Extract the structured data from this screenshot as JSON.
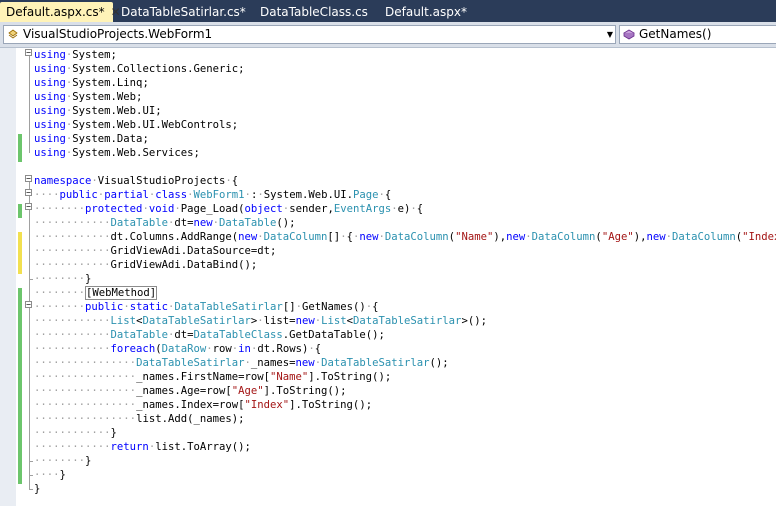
{
  "tabs": [
    {
      "label": "Default.aspx.cs*",
      "active": true
    },
    {
      "label": "DataTableSatirlar.cs*",
      "active": false
    },
    {
      "label": "DataTableClass.cs",
      "active": false
    },
    {
      "label": "Default.aspx*",
      "active": false
    }
  ],
  "navbar": {
    "class_combo": "VisualStudioProjects.WebForm1",
    "member_combo": "GetNames()"
  },
  "colors": {
    "keyword": "#0000ff",
    "type": "#2b91af",
    "string": "#a31515",
    "whitespace": "#a0a0a0",
    "change_saved": "#6cc56c",
    "change_unsaved": "#f2e050"
  },
  "code_lines": [
    [
      [
        "kw",
        "using"
      ],
      [
        "ws",
        "·"
      ],
      [
        "n",
        "System;"
      ]
    ],
    [
      [
        "kw",
        "using"
      ],
      [
        "ws",
        "·"
      ],
      [
        "n",
        "System.Collections.Generic;"
      ]
    ],
    [
      [
        "kw",
        "using"
      ],
      [
        "ws",
        "·"
      ],
      [
        "n",
        "System.Linq;"
      ]
    ],
    [
      [
        "kw",
        "using"
      ],
      [
        "ws",
        "·"
      ],
      [
        "n",
        "System.Web;"
      ]
    ],
    [
      [
        "kw",
        "using"
      ],
      [
        "ws",
        "·"
      ],
      [
        "n",
        "System.Web.UI;"
      ]
    ],
    [
      [
        "kw",
        "using"
      ],
      [
        "ws",
        "·"
      ],
      [
        "n",
        "System.Web.UI.WebControls;"
      ]
    ],
    [
      [
        "kw",
        "using"
      ],
      [
        "ws",
        "·"
      ],
      [
        "n",
        "System.Data;"
      ]
    ],
    [
      [
        "kw",
        "using"
      ],
      [
        "ws",
        "·"
      ],
      [
        "n",
        "System.Web.Services;"
      ]
    ],
    [],
    [
      [
        "kw",
        "namespace"
      ],
      [
        "ws",
        "·"
      ],
      [
        "n",
        "VisualStudioProjects"
      ],
      [
        "ws",
        "·"
      ],
      [
        "n",
        "{"
      ]
    ],
    [
      [
        "ws",
        "····"
      ],
      [
        "kw",
        "public"
      ],
      [
        "ws",
        "·"
      ],
      [
        "kw",
        "partial"
      ],
      [
        "ws",
        "·"
      ],
      [
        "kw",
        "class"
      ],
      [
        "ws",
        "·"
      ],
      [
        "ty",
        "WebForm1"
      ],
      [
        "ws",
        "·"
      ],
      [
        "n",
        ":"
      ],
      [
        "ws",
        "·"
      ],
      [
        "n",
        "System.Web.UI."
      ],
      [
        "ty",
        "Page"
      ],
      [
        "ws",
        "·"
      ],
      [
        "n",
        "{"
      ]
    ],
    [
      [
        "ws",
        "········"
      ],
      [
        "kw",
        "protected"
      ],
      [
        "ws",
        "·"
      ],
      [
        "kw",
        "void"
      ],
      [
        "ws",
        "·"
      ],
      [
        "n",
        "Page_Load("
      ],
      [
        "kw",
        "object"
      ],
      [
        "ws",
        "·"
      ],
      [
        "n",
        "sender,"
      ],
      [
        "ty",
        "EventArgs"
      ],
      [
        "ws",
        "·"
      ],
      [
        "n",
        "e)"
      ],
      [
        "ws",
        "·"
      ],
      [
        "n",
        "{"
      ]
    ],
    [
      [
        "ws",
        "············"
      ],
      [
        "ty",
        "DataTable"
      ],
      [
        "ws",
        "·"
      ],
      [
        "n",
        "dt="
      ],
      [
        "kw",
        "new"
      ],
      [
        "ws",
        "·"
      ],
      [
        "ty",
        "DataTable"
      ],
      [
        "n",
        "();"
      ]
    ],
    [
      [
        "ws",
        "············"
      ],
      [
        "n",
        "dt.Columns.AddRange("
      ],
      [
        "kw",
        "new"
      ],
      [
        "ws",
        "·"
      ],
      [
        "ty",
        "DataColumn"
      ],
      [
        "n",
        "[]"
      ],
      [
        "ws",
        "·"
      ],
      [
        "n",
        "{"
      ],
      [
        "ws",
        "·"
      ],
      [
        "kw",
        "new"
      ],
      [
        "ws",
        "·"
      ],
      [
        "ty",
        "DataColumn"
      ],
      [
        "n",
        "("
      ],
      [
        "st",
        "\"Name\""
      ],
      [
        "n",
        "),"
      ],
      [
        "kw",
        "new"
      ],
      [
        "ws",
        "·"
      ],
      [
        "ty",
        "DataColumn"
      ],
      [
        "n",
        "("
      ],
      [
        "st",
        "\"Age\""
      ],
      [
        "n",
        "),"
      ],
      [
        "kw",
        "new"
      ],
      [
        "ws",
        "·"
      ],
      [
        "ty",
        "DataColumn"
      ],
      [
        "n",
        "("
      ],
      [
        "st",
        "\"Index\""
      ],
      [
        "n",
        ")"
      ],
      [
        "ws",
        "·"
      ],
      [
        "n",
        "});"
      ]
    ],
    [
      [
        "ws",
        "············"
      ],
      [
        "n",
        "GridViewAdi.DataSource=dt;"
      ]
    ],
    [
      [
        "ws",
        "············"
      ],
      [
        "n",
        "GridViewAdi.DataBind();"
      ]
    ],
    [
      [
        "ws",
        "········"
      ],
      [
        "n",
        "}"
      ]
    ],
    [
      [
        "ws",
        "········"
      ],
      [
        "hl",
        "[WebMethod]"
      ]
    ],
    [
      [
        "ws",
        "········"
      ],
      [
        "kw",
        "public"
      ],
      [
        "ws",
        "·"
      ],
      [
        "kw",
        "static"
      ],
      [
        "ws",
        "·"
      ],
      [
        "ty",
        "DataTableSatirlar"
      ],
      [
        "n",
        "[]"
      ],
      [
        "ws",
        "·"
      ],
      [
        "n",
        "GetNames()"
      ],
      [
        "ws",
        "·"
      ],
      [
        "n",
        "{"
      ]
    ],
    [
      [
        "ws",
        "············"
      ],
      [
        "ty",
        "List"
      ],
      [
        "n",
        "<"
      ],
      [
        "ty",
        "DataTableSatirlar"
      ],
      [
        "n",
        ">"
      ],
      [
        "ws",
        "·"
      ],
      [
        "n",
        "list="
      ],
      [
        "kw",
        "new"
      ],
      [
        "ws",
        "·"
      ],
      [
        "ty",
        "List"
      ],
      [
        "n",
        "<"
      ],
      [
        "ty",
        "DataTableSatirlar"
      ],
      [
        "n",
        ">();"
      ]
    ],
    [
      [
        "ws",
        "············"
      ],
      [
        "ty",
        "DataTable"
      ],
      [
        "ws",
        "·"
      ],
      [
        "n",
        "dt="
      ],
      [
        "ty",
        "DataTableClass"
      ],
      [
        "n",
        ".GetDataTable();"
      ]
    ],
    [
      [
        "ws",
        "············"
      ],
      [
        "kw",
        "foreach"
      ],
      [
        "n",
        "("
      ],
      [
        "ty",
        "DataRow"
      ],
      [
        "ws",
        "·"
      ],
      [
        "n",
        "row"
      ],
      [
        "ws",
        "·"
      ],
      [
        "kw",
        "in"
      ],
      [
        "ws",
        "·"
      ],
      [
        "n",
        "dt.Rows)"
      ],
      [
        "ws",
        "·"
      ],
      [
        "n",
        "{"
      ]
    ],
    [
      [
        "ws",
        "················"
      ],
      [
        "ty",
        "DataTableSatirlar"
      ],
      [
        "ws",
        "·"
      ],
      [
        "n",
        "_names="
      ],
      [
        "kw",
        "new"
      ],
      [
        "ws",
        "·"
      ],
      [
        "ty",
        "DataTableSatirlar"
      ],
      [
        "n",
        "();"
      ]
    ],
    [
      [
        "ws",
        "················"
      ],
      [
        "n",
        "_names.FirstName=row["
      ],
      [
        "st",
        "\"Name\""
      ],
      [
        "n",
        "].ToString();"
      ]
    ],
    [
      [
        "ws",
        "················"
      ],
      [
        "n",
        "_names.Age=row["
      ],
      [
        "st",
        "\"Age\""
      ],
      [
        "n",
        "].ToString();"
      ]
    ],
    [
      [
        "ws",
        "················"
      ],
      [
        "n",
        "_names.Index=row["
      ],
      [
        "st",
        "\"Index\""
      ],
      [
        "n",
        "].ToString();"
      ]
    ],
    [
      [
        "ws",
        "················"
      ],
      [
        "n",
        "list.Add(_names);"
      ]
    ],
    [
      [
        "ws",
        "············"
      ],
      [
        "n",
        "}"
      ]
    ],
    [
      [
        "ws",
        "············"
      ],
      [
        "kw",
        "return"
      ],
      [
        "ws",
        "·"
      ],
      [
        "n",
        "list.ToArray();"
      ]
    ],
    [
      [
        "ws",
        "········"
      ],
      [
        "n",
        "}"
      ]
    ],
    [
      [
        "ws",
        "····"
      ],
      [
        "n",
        "}"
      ]
    ],
    [
      [
        "n",
        "}"
      ]
    ]
  ],
  "change_markers": [
    {
      "from": 6,
      "to": 8,
      "state": "saved"
    },
    {
      "from": 11,
      "to": 12,
      "state": "saved"
    },
    {
      "from": 13,
      "to": 16,
      "state": "unsaved"
    },
    {
      "from": 17,
      "to": 19,
      "state": "saved"
    },
    {
      "from": 19,
      "to": 31,
      "state": "saved"
    }
  ]
}
